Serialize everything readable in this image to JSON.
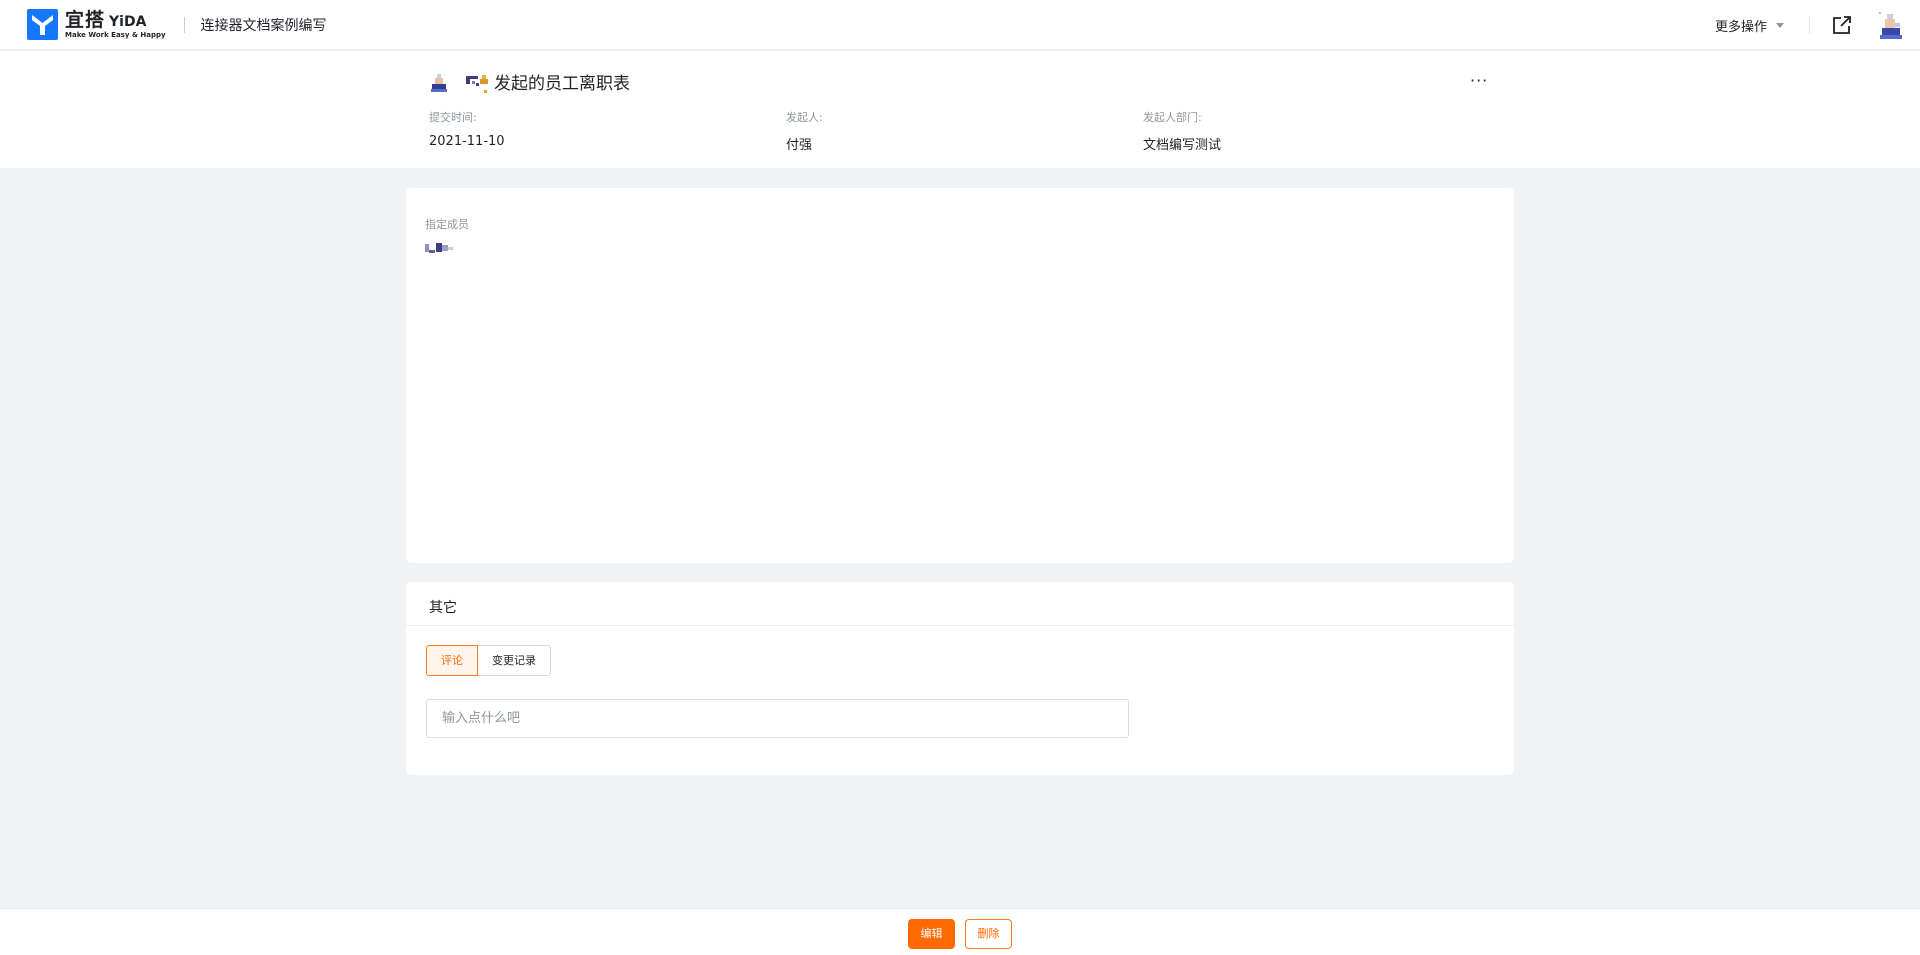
{
  "brand": {
    "name_cn": "宜搭",
    "name_en": "YiDA",
    "slogan": "Make Work Easy & Happy",
    "color": "#1677ff"
  },
  "topbar": {
    "app_title": "连接器文档案例编写",
    "more_ops_label": "更多操作"
  },
  "header": {
    "title": "发起的员工离职表",
    "more_icon": "···",
    "meta": [
      {
        "label": "提交时间:",
        "value": "2021-11-10"
      },
      {
        "label": "发起人:",
        "value": "付强"
      },
      {
        "label": "发起人部门:",
        "value": "文档编写测试"
      }
    ]
  },
  "members_card": {
    "label": "指定成员"
  },
  "other_card": {
    "title": "其它",
    "tabs": [
      "评论",
      "变更记录"
    ],
    "comment_placeholder": "输入点什么吧"
  },
  "actions": {
    "edit_label": "编辑",
    "delete_label": "删除"
  },
  "colors": {
    "accent": "#ff6a00",
    "page_bg": "#f1f2f3"
  }
}
